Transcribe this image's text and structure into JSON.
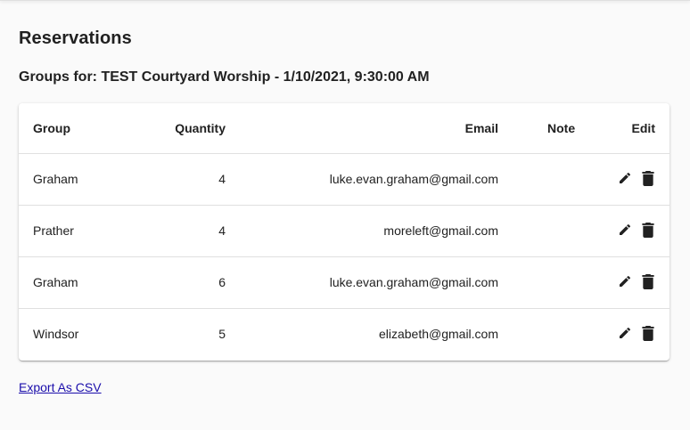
{
  "page": {
    "title": "Reservations",
    "subtitle": "Groups for: TEST Courtyard Worship - 1/10/2021, 9:30:00 AM"
  },
  "table": {
    "headers": {
      "group": "Group",
      "quantity": "Quantity",
      "email": "Email",
      "note": "Note",
      "edit": "Edit"
    },
    "rows": [
      {
        "group": "Graham",
        "quantity": "4",
        "email": "luke.evan.graham@gmail.com",
        "note": ""
      },
      {
        "group": "Prather",
        "quantity": "4",
        "email": "moreleft@gmail.com",
        "note": ""
      },
      {
        "group": "Graham",
        "quantity": "6",
        "email": "luke.evan.graham@gmail.com",
        "note": ""
      },
      {
        "group": "Windsor",
        "quantity": "5",
        "email": "elizabeth@gmail.com",
        "note": ""
      }
    ],
    "row_icons": {
      "edit": "pencil-icon",
      "delete": "trash-icon"
    }
  },
  "export": {
    "label": "Export As CSV"
  },
  "colors": {
    "link": "#1a0dab",
    "background": "#fafafa",
    "card": "#ffffff"
  }
}
